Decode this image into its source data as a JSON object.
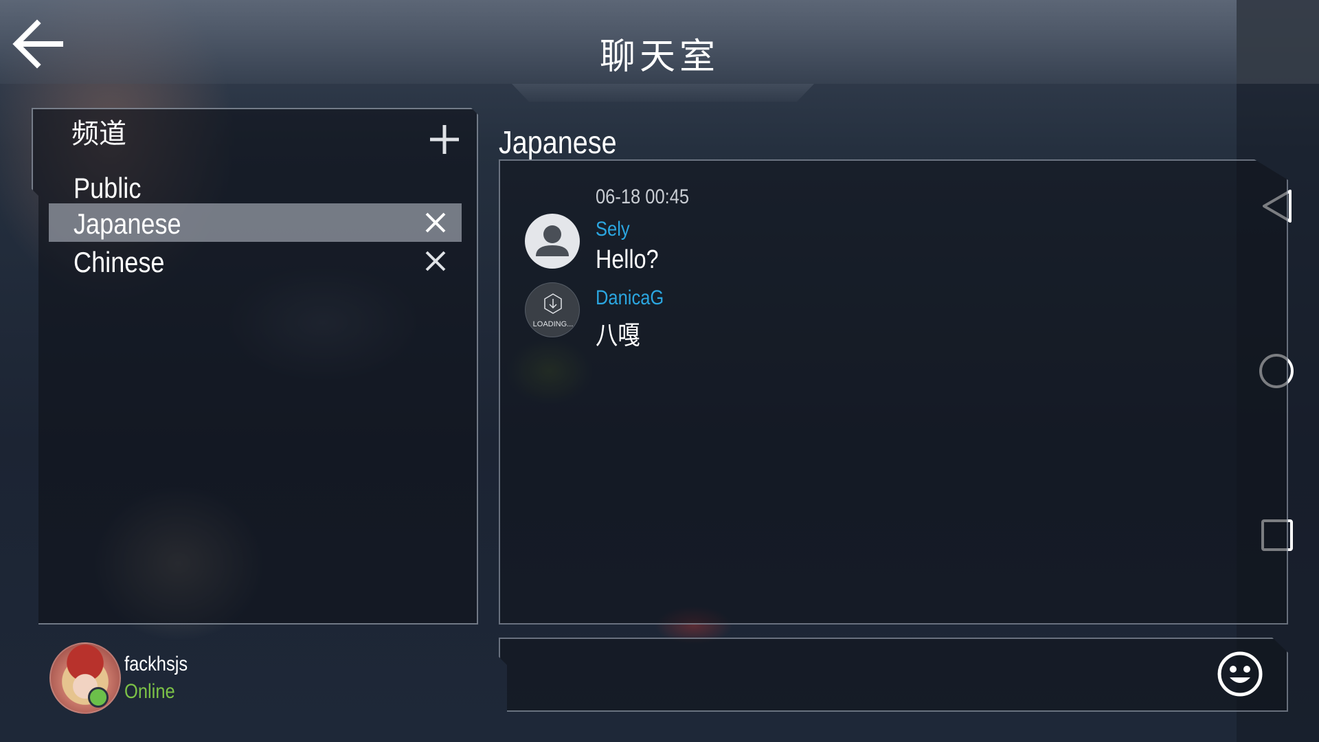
{
  "header": {
    "title": "聊天室"
  },
  "channels_panel": {
    "heading": "频道",
    "channels": [
      {
        "label": "Public",
        "active": false,
        "closable": false
      },
      {
        "label": "Japanese",
        "active": true,
        "closable": true
      },
      {
        "label": "Chinese",
        "active": false,
        "closable": true
      }
    ]
  },
  "user": {
    "name": "fackhsjs",
    "status": "Online"
  },
  "chat": {
    "channel_title": "Japanese",
    "timestamp": "06-18 00:45",
    "messages": [
      {
        "sender": "Sely",
        "text": "Hello?",
        "avatar": "default-user-icon"
      },
      {
        "sender": "DanicaG",
        "text": "八嘎",
        "avatar": "loading",
        "avatar_text": "LOADING..."
      }
    ]
  },
  "colors": {
    "accent_name": "#2ba6e0",
    "online": "#7cc247",
    "active_channel": "#969ba5"
  },
  "icons": {
    "back": "back-arrow-icon",
    "add": "plus-icon",
    "close": "close-icon",
    "emoji": "smiley-icon"
  }
}
